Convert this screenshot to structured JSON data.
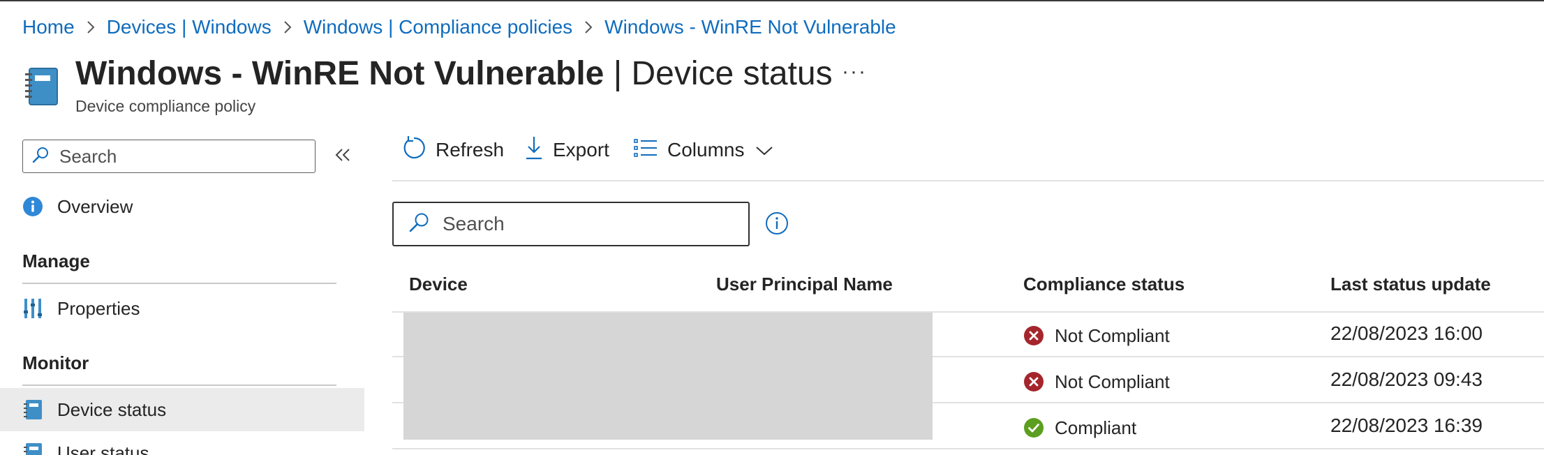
{
  "breadcrumb": {
    "items": [
      "Home",
      "Devices | Windows",
      "Windows | Compliance policies",
      "Windows - WinRE Not Vulnerable"
    ]
  },
  "header": {
    "title": "Windows - WinRE Not Vulnerable",
    "title_suffix": "| Device status",
    "subtitle": "Device compliance policy",
    "more_label": "···"
  },
  "sidebar": {
    "search_placeholder": "Search",
    "overview": "Overview",
    "manage_heading": "Manage",
    "properties": "Properties",
    "monitor_heading": "Monitor",
    "device_status": "Device status",
    "user_status": "User status"
  },
  "toolbar": {
    "refresh": "Refresh",
    "export": "Export",
    "columns": "Columns"
  },
  "main_search": {
    "placeholder": "Search"
  },
  "table": {
    "headers": [
      "Device",
      "User Principal Name",
      "Compliance status",
      "Last status update"
    ],
    "rows": [
      {
        "device": "",
        "upn": "",
        "status": "Not Compliant",
        "status_kind": "error",
        "last_update": "22/08/2023 16:00"
      },
      {
        "device": "",
        "upn": "",
        "status": "Not Compliant",
        "status_kind": "error",
        "last_update": "22/08/2023 09:43"
      },
      {
        "device": "",
        "upn": "",
        "status": "Compliant",
        "status_kind": "success",
        "last_update": "22/08/2023 16:39"
      }
    ]
  },
  "colors": {
    "link": "#0f6cbd",
    "error": "#a4262c",
    "success": "#5c9e1f",
    "active_nav": "#ebebeb"
  },
  "icons": {
    "title": "policy-book-icon",
    "overview": "info-icon",
    "properties": "properties-bars-icon",
    "device_status": "policy-book-icon",
    "refresh": "refresh-icon",
    "export": "download-icon",
    "columns": "list-columns-icon"
  }
}
